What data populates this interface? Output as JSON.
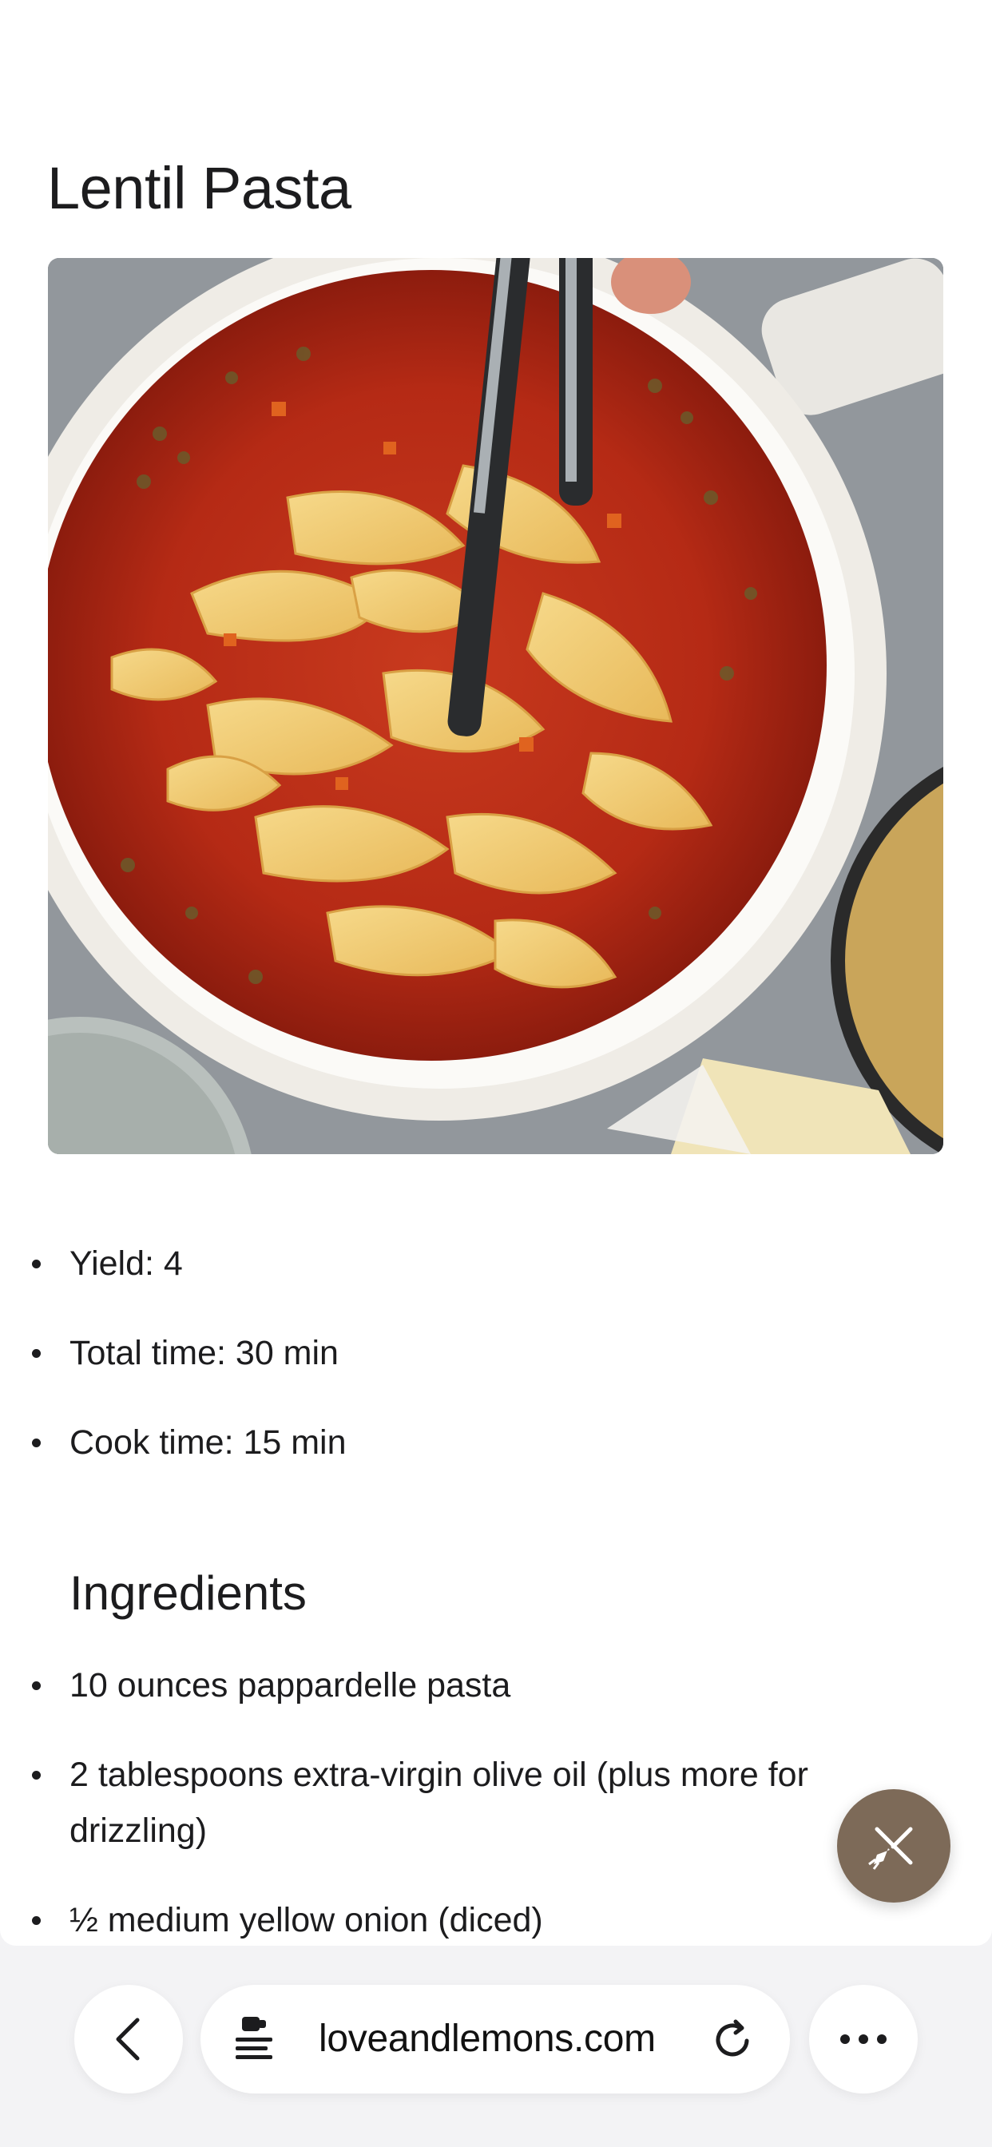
{
  "article": {
    "title": "Lentil Pasta",
    "hero_image": "lentil-pasta-photo"
  },
  "meta": [
    {
      "label": "Yield: 4"
    },
    {
      "label": "Total time: 30 min"
    },
    {
      "label": "Cook time: 15 min"
    }
  ],
  "ingredients": {
    "heading": "Ingredients",
    "items": [
      "10 ounces pappardelle pasta",
      "2 tablespoons extra-virgin olive oil (plus more for drizzling)",
      "½ medium yellow onion (diced)"
    ]
  },
  "fab": {
    "icon": "utensils-broom-icon",
    "color": "#7d6a58"
  },
  "browser": {
    "url": "loveandlemons.com",
    "back_icon": "chevron-left-icon",
    "reader_icon": "reader-mode-icon",
    "reload_icon": "reload-icon",
    "more_icon": "more-dots-icon"
  }
}
